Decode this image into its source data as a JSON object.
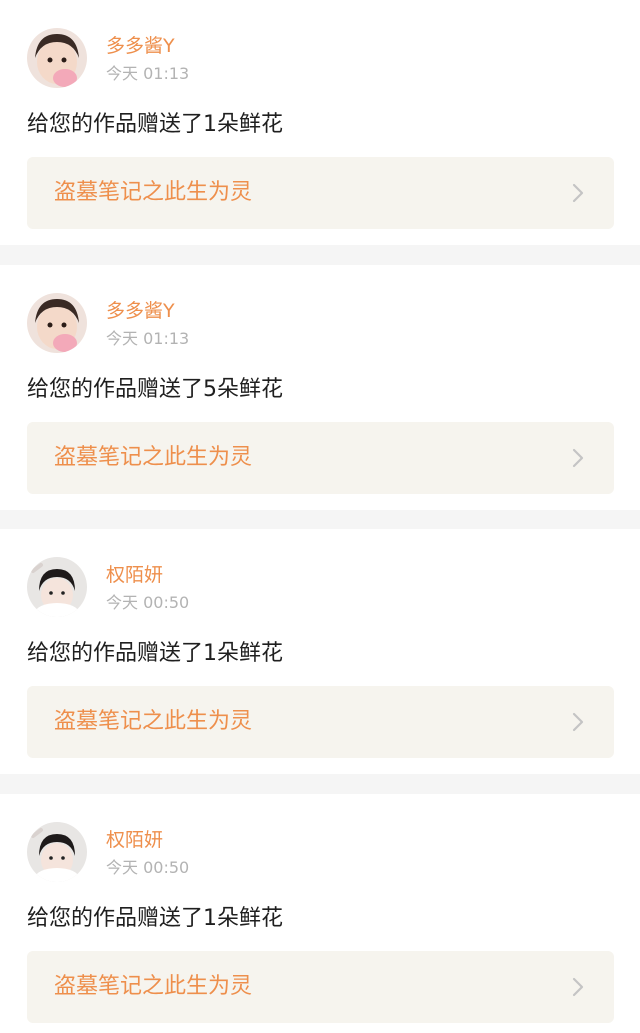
{
  "colors": {
    "accent": "#ee8f4c",
    "timestamp": "#b3b3b3",
    "message": "#1f1f1f",
    "card_bg": "#ffffff",
    "link_bg": "#f6f4ee",
    "page_bg": "#f5f5f5"
  },
  "notifications": [
    {
      "username": "多多酱Y",
      "time": "今天 01:13",
      "message": "给您的作品赠送了1朵鲜花",
      "work_title": "盗墓笔记之此生为灵",
      "icon": "chevron-right-icon"
    },
    {
      "username": "多多酱Y",
      "time": "今天 01:13",
      "message": "给您的作品赠送了5朵鲜花",
      "work_title": "盗墓笔记之此生为灵",
      "icon": "chevron-right-icon"
    },
    {
      "username": "权陌妍",
      "time": "今天 00:50",
      "message": "给您的作品赠送了1朵鲜花",
      "work_title": "盗墓笔记之此生为灵",
      "icon": "chevron-right-icon"
    },
    {
      "username": "权陌妍",
      "time": "今天 00:50",
      "message": "给您的作品赠送了1朵鲜花",
      "work_title": "盗墓笔记之此生为灵",
      "icon": "chevron-right-icon"
    }
  ]
}
